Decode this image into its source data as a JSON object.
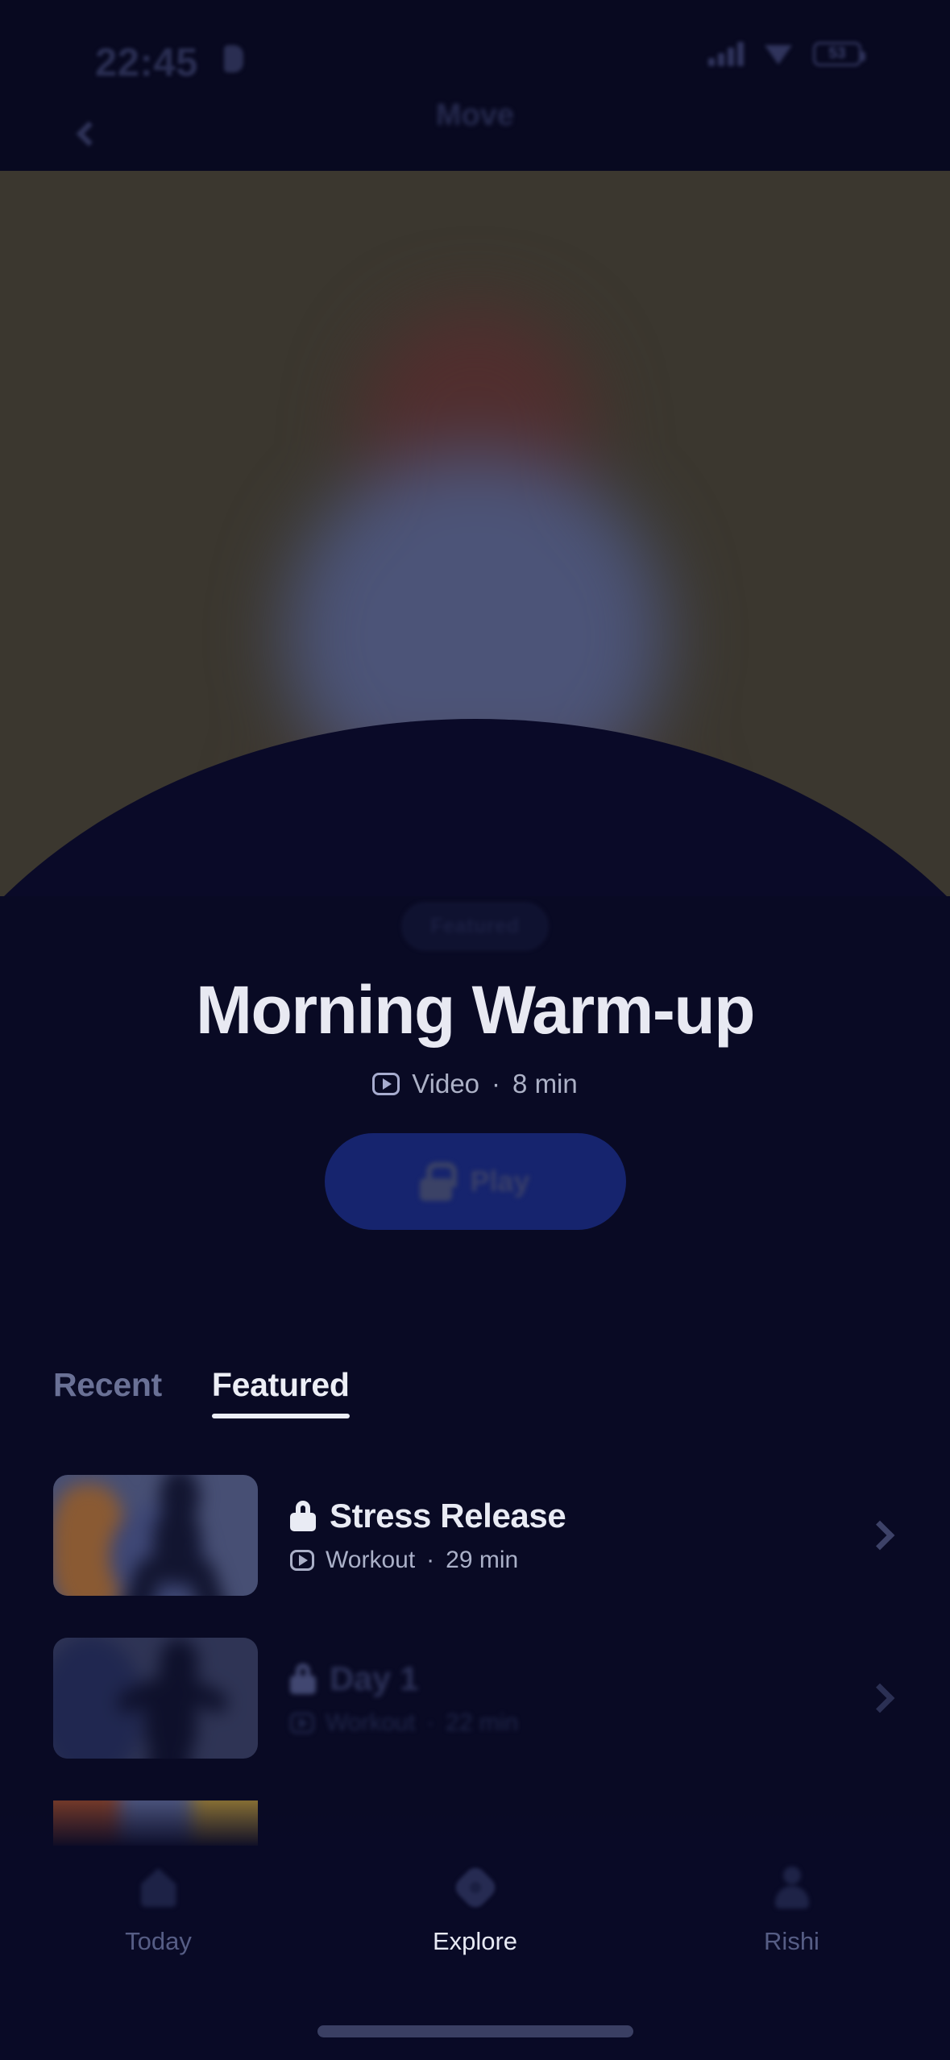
{
  "status_bar": {
    "time": "22:45",
    "time_icon": "alarm-icon",
    "signal_icon": "cellular-signal-icon",
    "wifi_icon": "wifi-icon",
    "battery_icon": "battery-icon",
    "battery_level": "53"
  },
  "nav": {
    "back_icon": "chevron-left-icon",
    "title": "Move"
  },
  "hero": {
    "image_alt": "blurred-abstract-figure",
    "background_color": "#3b372f",
    "head_color": "#512e2e",
    "body_color": "#4c5478"
  },
  "feature": {
    "badge": "Featured",
    "title": "Morning Warm-up",
    "type": "Video",
    "separator": "·",
    "duration": "8 min",
    "media_icon": "video-play-icon",
    "cta": {
      "label": "Play",
      "lock_icon": "lock-icon",
      "color": "#16246e"
    }
  },
  "tabs": [
    {
      "label": "Recent",
      "active": false
    },
    {
      "label": "Featured",
      "active": true
    }
  ],
  "list": [
    {
      "title": "Stress Release",
      "type": "Workout",
      "separator": "·",
      "duration": "29 min",
      "locked": true,
      "lock_icon": "lock-icon",
      "media_icon": "video-play-icon",
      "chevron_icon": "chevron-right-icon",
      "thumbnail": "blurred-person-stretching",
      "dimmed": false
    },
    {
      "title": "Day 1",
      "type": "Workout",
      "separator": "·",
      "duration": "22 min",
      "locked": true,
      "lock_icon": "lock-icon",
      "media_icon": "video-play-icon",
      "chevron_icon": "chevron-right-icon",
      "thumbnail": "blurred-person-posing",
      "dimmed": true
    }
  ],
  "bottom_nav": [
    {
      "label": "Today",
      "icon": "home-icon",
      "active": false
    },
    {
      "label": "Explore",
      "icon": "sparkle-icon",
      "active": true
    },
    {
      "label": "Rishi",
      "icon": "person-icon",
      "active": false
    }
  ],
  "colors": {
    "background": "#090a24",
    "accent": "#16246e",
    "text_primary": "#e9ebf4",
    "text_muted": "#aab0c8"
  }
}
